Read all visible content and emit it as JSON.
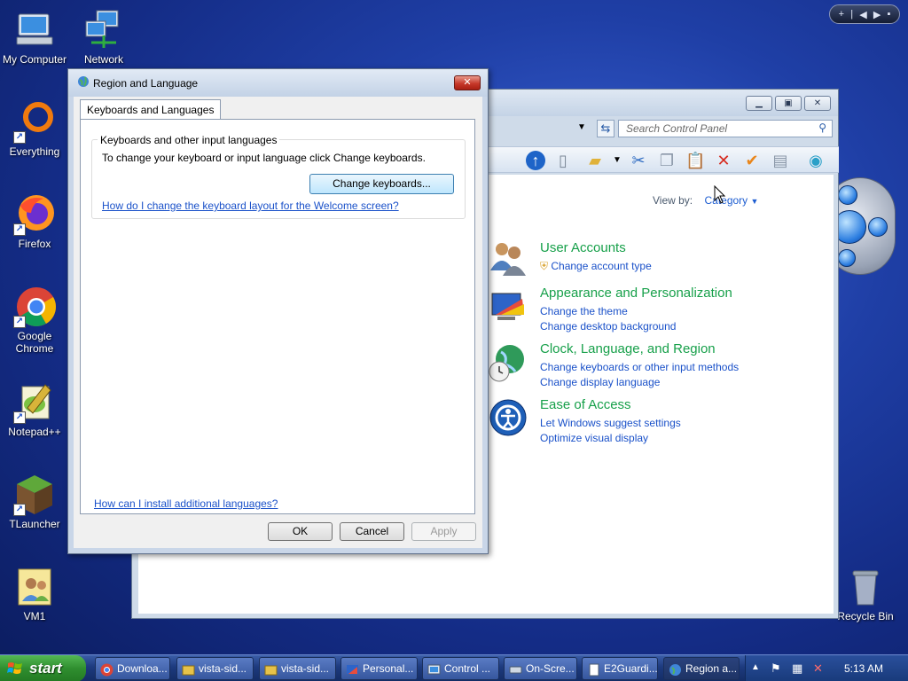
{
  "desktop": {
    "icons": [
      {
        "label": "My Computer"
      },
      {
        "label": "Network"
      },
      {
        "label": "Everything"
      },
      {
        "label": "Firefox"
      },
      {
        "label": "Google Chrome"
      },
      {
        "label": "Notepad++"
      },
      {
        "label": "TLauncher"
      },
      {
        "label": "VM1"
      },
      {
        "label": "Recycle Bin"
      }
    ]
  },
  "control_panel": {
    "search_placeholder": "Search Control Panel",
    "view_by_label": "View by:",
    "view_by_value": "Category",
    "categories": [
      {
        "title": "User Accounts",
        "links": [
          "Change account type"
        ]
      },
      {
        "title": "Appearance and Personalization",
        "links": [
          "Change the theme",
          "Change desktop background"
        ]
      },
      {
        "title": "Clock, Language, and Region",
        "links": [
          "Change keyboards or other input methods",
          "Change display language"
        ]
      },
      {
        "title": "Ease of Access",
        "links": [
          "Let Windows suggest settings",
          "Optimize visual display"
        ]
      }
    ]
  },
  "dialog": {
    "title": "Region and Language",
    "tab_label": "Keyboards and Languages",
    "group_label": "Keyboards and other input languages",
    "group_text": "To change your keyboard or input language click Change keyboards.",
    "change_button": "Change keyboards...",
    "welcome_link": "How do I change the keyboard layout for the Welcome screen?",
    "install_link": "How can I install additional languages?",
    "ok": "OK",
    "cancel": "Cancel",
    "apply": "Apply"
  },
  "taskbar": {
    "start_label": "start",
    "items": [
      {
        "label": "Downloa..."
      },
      {
        "label": "vista-sid..."
      },
      {
        "label": "vista-sid..."
      },
      {
        "label": "Personal..."
      },
      {
        "label": "Control ..."
      },
      {
        "label": "On-Scre..."
      },
      {
        "label": "E2Guardi..."
      },
      {
        "label": "Region a..."
      }
    ],
    "clock": "5:13 AM"
  },
  "colors": {
    "category_title": "#17a04a",
    "link": "#1a51c9",
    "desktop_bg": "#1f3fa6"
  }
}
